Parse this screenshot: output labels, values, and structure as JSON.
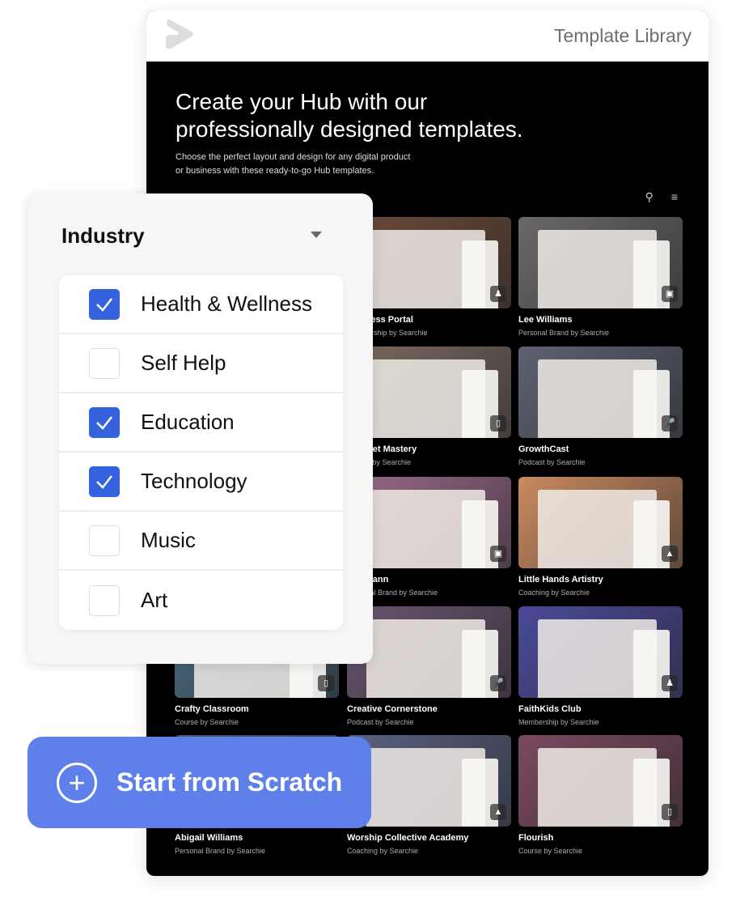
{
  "header": {
    "title": "Template Library",
    "logo_icon": "searchie-logo-icon"
  },
  "hero": {
    "heading_line1": "Create your Hub with our",
    "heading_line2": "professionally designed templates.",
    "sub_line1": "Choose the perfect layout and design for any digital product",
    "sub_line2": "or business with these ready-to-go Hub templates."
  },
  "tools": {
    "search_icon": "search-icon",
    "sort_icon": "sort-icon"
  },
  "templates": [
    {
      "title": "Progress Portal",
      "subtitle": "Membership by Searchie",
      "icon": "members-icon",
      "color": "#6b4a3a",
      "col": 1,
      "row": 0
    },
    {
      "title": "Lee Williams",
      "subtitle": "Personal Brand by Searchie",
      "icon": "portrait-icon",
      "color": "#6a6868",
      "col": 2,
      "row": 0
    },
    {
      "title": "Mindset Mastery",
      "subtitle": "Course by Searchie",
      "icon": "course-icon",
      "color": "#7a6a60",
      "col": 1,
      "row": 1
    },
    {
      "title": "GrowthCast",
      "subtitle": "Podcast by Searchie",
      "icon": "microphone-icon",
      "color": "#5d6272",
      "col": 2,
      "row": 1
    },
    {
      "title": "Hoffmann",
      "subtitle": "Personal Brand by Searchie",
      "icon": "portrait-icon",
      "color": "#9a6a8a",
      "col": 1,
      "row": 2
    },
    {
      "title": "Little Hands Artistry",
      "subtitle": "Coaching by Searchie",
      "icon": "graduation-cap-icon",
      "color": "#c98a60",
      "col": 2,
      "row": 2
    },
    {
      "title": "Crafty Classroom",
      "subtitle": "Course by Searchie",
      "icon": "course-icon",
      "color": "#4a6a80",
      "col": 0,
      "row": 3
    },
    {
      "title": "Creative Cornerstone",
      "subtitle": "Podcast by Searchie",
      "icon": "microphone-icon",
      "color": "#6a5570",
      "col": 1,
      "row": 3
    },
    {
      "title": "FaithKids Club",
      "subtitle": "Membership by Searchie",
      "icon": "members-icon",
      "color": "#4a4a9a",
      "col": 2,
      "row": 3
    },
    {
      "title": "Abigail Williams",
      "subtitle": "Personal Brand by Searchie",
      "icon": "portrait-icon",
      "color": "#4a5a70",
      "col": 0,
      "row": 4
    },
    {
      "title": "Worship Collective Academy",
      "subtitle": "Coaching by Searchie",
      "icon": "graduation-cap-icon",
      "color": "#5a6080",
      "col": 1,
      "row": 4
    },
    {
      "title": "Flourish",
      "subtitle": "Course by Searchie",
      "icon": "course-icon",
      "color": "#7a4a60",
      "col": 2,
      "row": 4
    }
  ],
  "filter": {
    "title": "Industry",
    "options": [
      {
        "label": "Health & Wellness",
        "checked": true
      },
      {
        "label": "Self Help",
        "checked": false
      },
      {
        "label": "Education",
        "checked": true
      },
      {
        "label": "Technology",
        "checked": true
      },
      {
        "label": "Music",
        "checked": false
      },
      {
        "label": "Art",
        "checked": false
      }
    ],
    "accent": "#3563e0"
  },
  "cta": {
    "label": "Start from Scratch",
    "color": "#5f80ea"
  }
}
